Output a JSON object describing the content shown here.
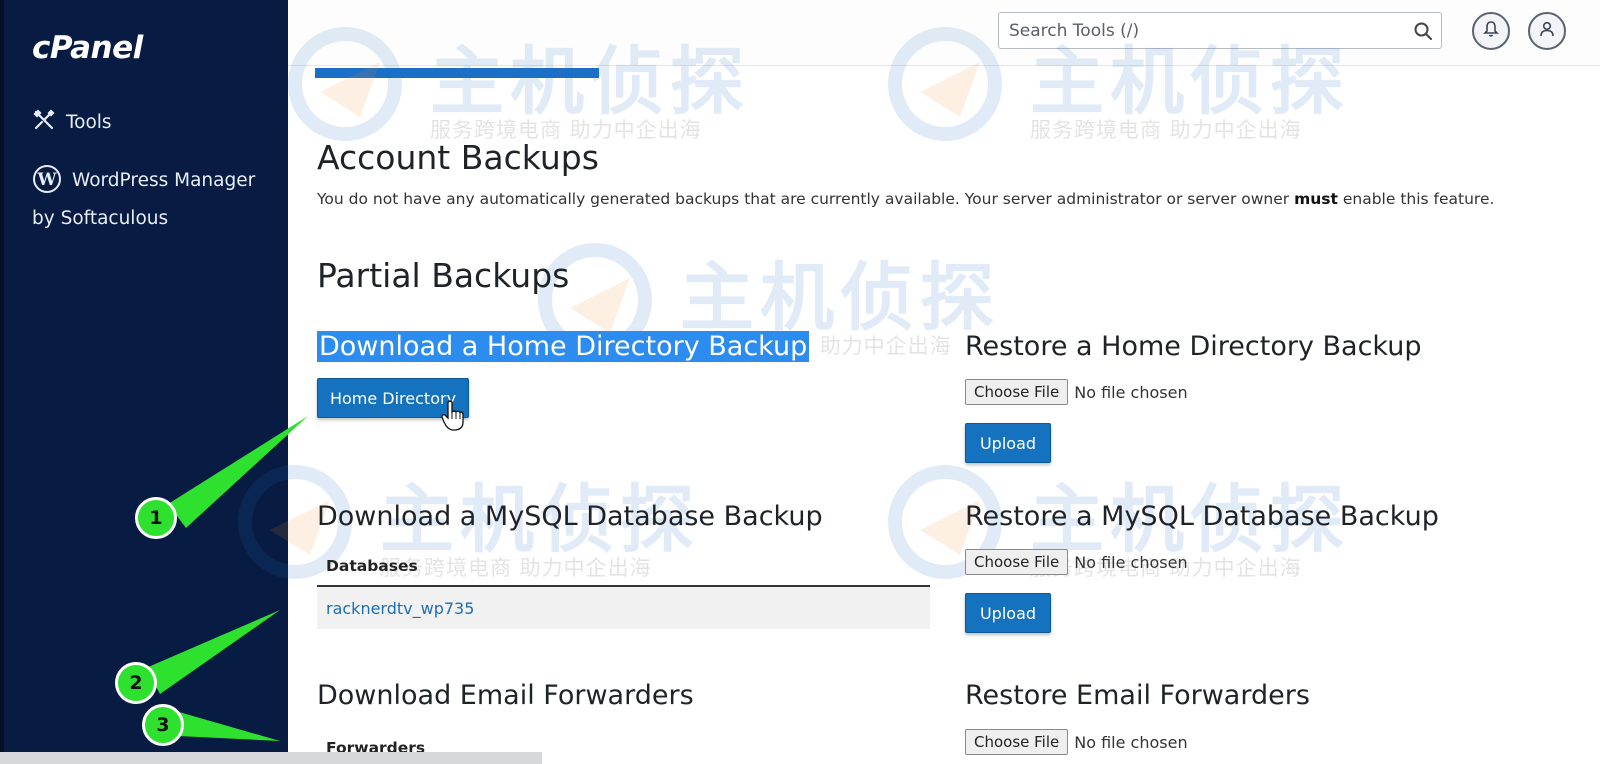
{
  "sidebar": {
    "logo": "cPanel",
    "items": [
      {
        "label": "Tools",
        "icon": "tools-icon"
      },
      {
        "label": "WordPress Manager by Softaculous",
        "icon": "wordpress-icon"
      }
    ]
  },
  "header": {
    "search_placeholder": "Search Tools (/)",
    "icons": [
      "search-icon",
      "bell-icon",
      "user-icon"
    ]
  },
  "account_backups": {
    "title": "Account Backups",
    "desc_before": "You do not have any automatically generated backups that are currently available. Your server administrator or server owner ",
    "desc_bold": "must",
    "desc_after": " enable this feature."
  },
  "partial_backups": {
    "title": "Partial Backups",
    "home_download": {
      "title": "Download a Home Directory Backup",
      "button": "Home Directory"
    },
    "home_restore": {
      "title": "Restore a Home Directory Backup",
      "choose": "Choose File",
      "status": "No file chosen",
      "button": "Upload"
    },
    "mysql_download": {
      "title": "Download a MySQL Database Backup",
      "column": "Databases",
      "rows": [
        "racknerdtv_wp735"
      ]
    },
    "mysql_restore": {
      "title": "Restore a MySQL Database Backup",
      "choose": "Choose File",
      "status": "No file chosen",
      "button": "Upload"
    },
    "email_download": {
      "title": "Download Email Forwarders",
      "column": "Forwarders"
    },
    "email_restore": {
      "title": "Restore Email Forwarders",
      "choose": "Choose File",
      "status": "No file chosen"
    }
  },
  "watermark": {
    "main": "主机侦探",
    "sub": "服务跨境电商  助力中企出海"
  },
  "annotations": [
    "1",
    "2",
    "3"
  ],
  "colors": {
    "sidebar": "#081c43",
    "primary": "#1472bf",
    "highlight": "#2d8cf0",
    "annotation": "#2ee12e"
  }
}
